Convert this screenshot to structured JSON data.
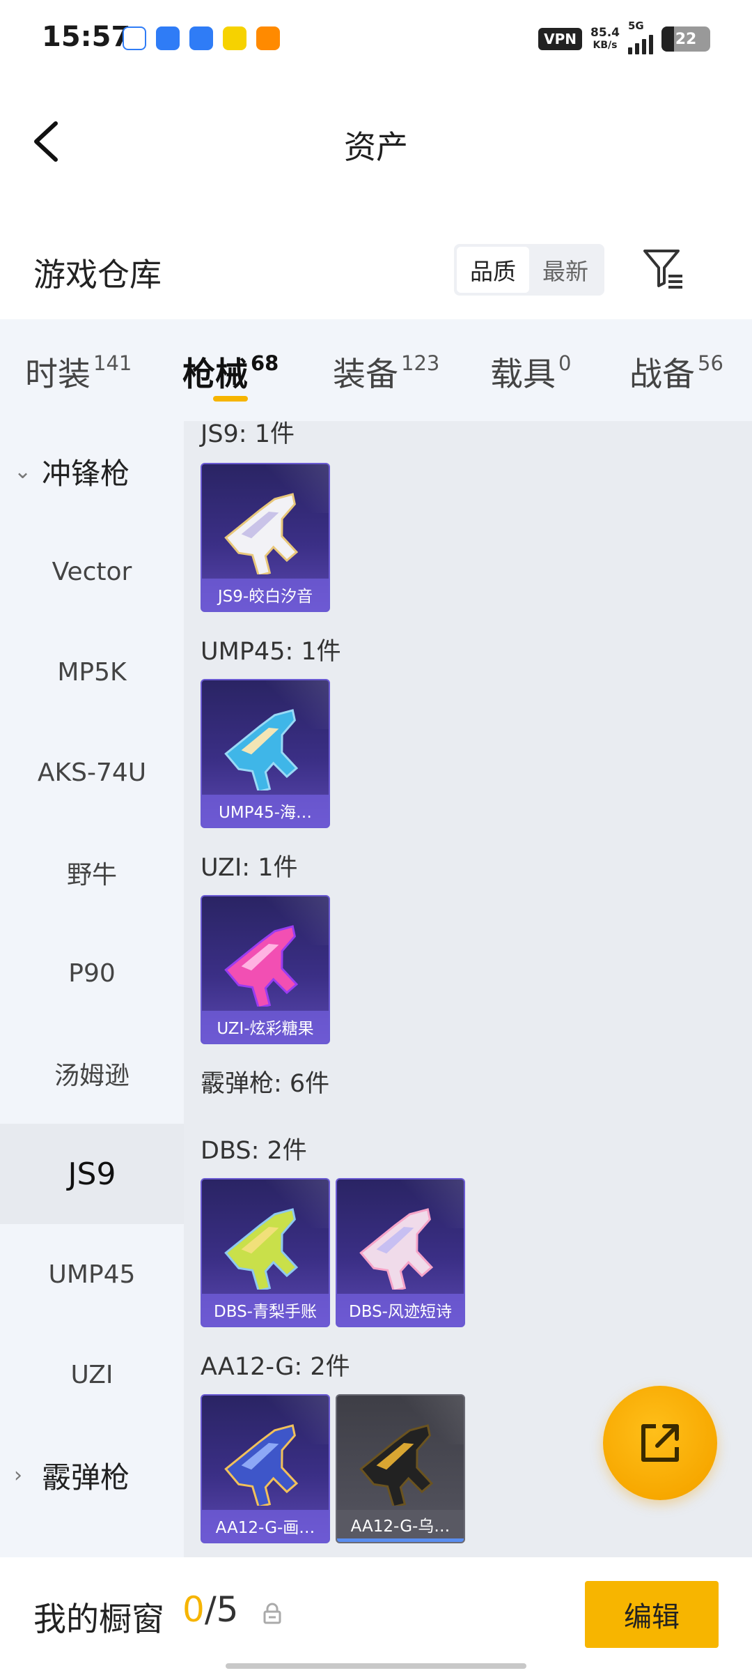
{
  "status_bar": {
    "time": "15:57",
    "vpn": "VPN",
    "speed_value": "85.4",
    "speed_unit": "KB/s",
    "network": "5G",
    "battery": "22",
    "app_colors": [
      "#ffffff",
      "#2f7cf6",
      "#2f7cf6",
      "#f6d200",
      "#ff8a00"
    ]
  },
  "header": {
    "title": "资产"
  },
  "warehouse": {
    "title": "游戏仓库",
    "sort_options": [
      "品质",
      "最新"
    ],
    "active_sort": "品质"
  },
  "tabs": [
    {
      "label": "时装",
      "count": "141"
    },
    {
      "label": "枪械",
      "count": "68",
      "active": true
    },
    {
      "label": "装备",
      "count": "123"
    },
    {
      "label": "载具",
      "count": "0"
    },
    {
      "label": "战备",
      "count": "56"
    }
  ],
  "sidebar": {
    "items": [
      {
        "label": "冲锋枪",
        "type": "group",
        "expanded": true
      },
      {
        "label": "Vector"
      },
      {
        "label": "MP5K"
      },
      {
        "label": "AKS-74U"
      },
      {
        "label": "野牛"
      },
      {
        "label": "P90"
      },
      {
        "label": "汤姆逊"
      },
      {
        "label": "JS9",
        "active": true
      },
      {
        "label": "UMP45"
      },
      {
        "label": "UZI"
      },
      {
        "label": "霰弹枪",
        "type": "group",
        "expanded": false
      }
    ]
  },
  "content": {
    "sections": [
      {
        "label": "JS9: 1件",
        "items": [
          {
            "name": "JS9-皎白汐音",
            "gun_colors": [
              "#f2f2f6",
              "#c9c3e8",
              "#e8c77a"
            ]
          }
        ]
      },
      {
        "label": "UMP45: 1件",
        "items": [
          {
            "name": "UMP45-海…",
            "gun_colors": [
              "#3fb6e8",
              "#f3e5b5",
              "#9ad9f6"
            ]
          }
        ]
      },
      {
        "label": "UZI: 1件",
        "items": [
          {
            "name": "UZI-炫彩糖果",
            "gun_colors": [
              "#f24fb3",
              "#ffb3e2",
              "#9a3cf0"
            ]
          }
        ]
      },
      {
        "label": "霰弹枪: 6件",
        "items": []
      },
      {
        "label": "DBS: 2件",
        "items": [
          {
            "name": "DBS-青梨手账",
            "gun_colors": [
              "#c9e04a",
              "#f1e07a",
              "#8ec8f0"
            ]
          },
          {
            "name": "DBS-风迹短诗",
            "gun_colors": [
              "#f0dbea",
              "#c7bff2",
              "#f6a4c8"
            ]
          }
        ]
      },
      {
        "label": "AA12-G: 2件",
        "items": [
          {
            "name": "AA12-G-画…",
            "gun_colors": [
              "#3e56c9",
              "#8da8f6",
              "#f2c15a"
            ]
          },
          {
            "name": "AA12-G-乌…",
            "gun_colors": [
              "#222222",
              "#d9a632",
              "#6a5320"
            ],
            "gray": true
          }
        ]
      }
    ]
  },
  "bottom_bar": {
    "title": "我的橱窗",
    "count_current": "0",
    "count_sep_total": "/5",
    "edit_label": "编辑"
  },
  "colors": {
    "accent": "#f6b400",
    "card_purple": "#3b2f86"
  }
}
